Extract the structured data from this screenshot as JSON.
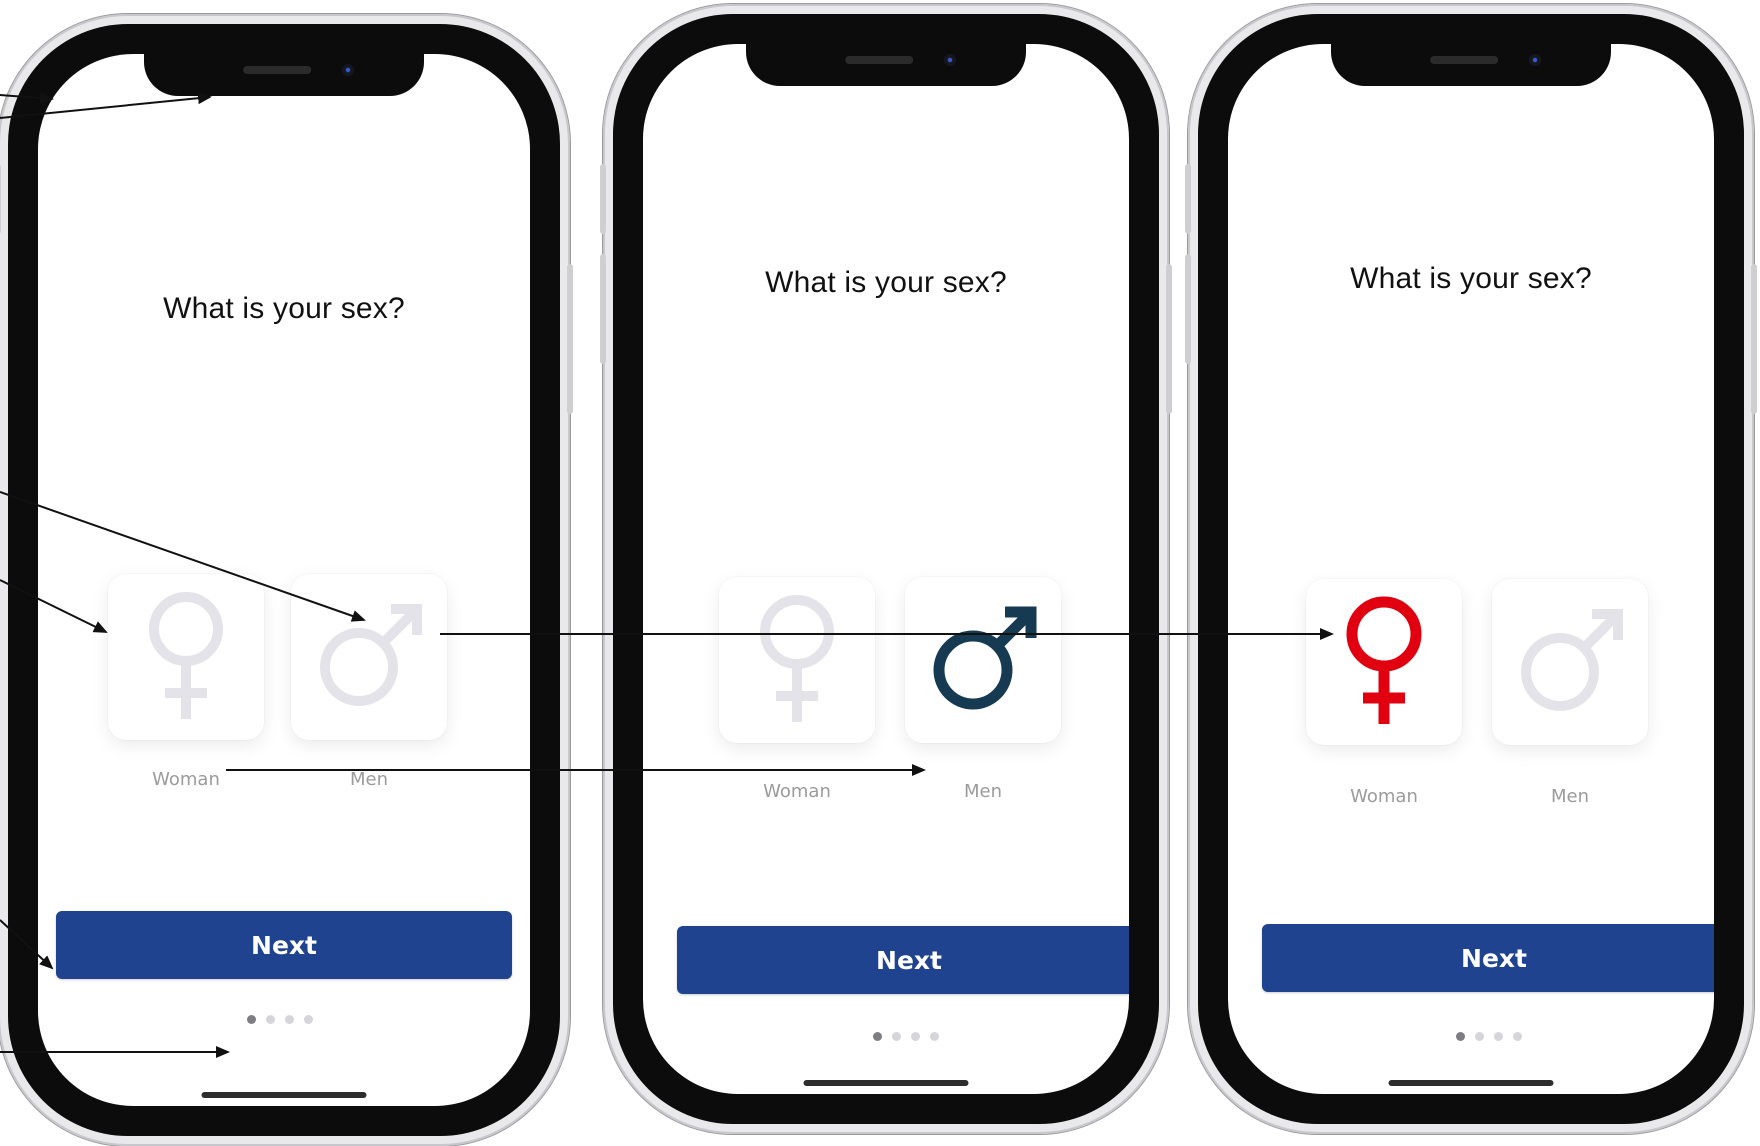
{
  "screens": [
    {
      "question": "What is your sex?",
      "options": [
        {
          "label": "Woman",
          "icon": "female-symbol-icon",
          "state": "unselected",
          "color": "#e4e3ea"
        },
        {
          "label": "Men",
          "icon": "male-symbol-icon",
          "state": "unselected",
          "color": "#e4e3ea"
        }
      ],
      "next_label": "Next",
      "page_indicator": {
        "total": 4,
        "active": 1
      }
    },
    {
      "question": "What is your sex?",
      "options": [
        {
          "label": "Woman",
          "icon": "female-symbol-icon",
          "state": "unselected",
          "color": "#e4e3ea"
        },
        {
          "label": "Men",
          "icon": "male-symbol-icon",
          "state": "selected",
          "color": "#163a52"
        }
      ],
      "next_label": "Next",
      "page_indicator": {
        "total": 4,
        "active": 1
      }
    },
    {
      "question": "What is your sex?",
      "options": [
        {
          "label": "Woman",
          "icon": "female-symbol-icon",
          "state": "selected",
          "color": "#e0000f"
        },
        {
          "label": "Men",
          "icon": "male-symbol-icon",
          "state": "unselected",
          "color": "#e4e3ea"
        }
      ],
      "next_label": "Next",
      "page_indicator": {
        "total": 4,
        "active": 1
      }
    }
  ],
  "colors": {
    "primary_button": "#1f438e",
    "unselected_icon": "#e4e3ea",
    "male_selected": "#163a52",
    "female_selected": "#e0000f",
    "arrow": "#111111"
  }
}
